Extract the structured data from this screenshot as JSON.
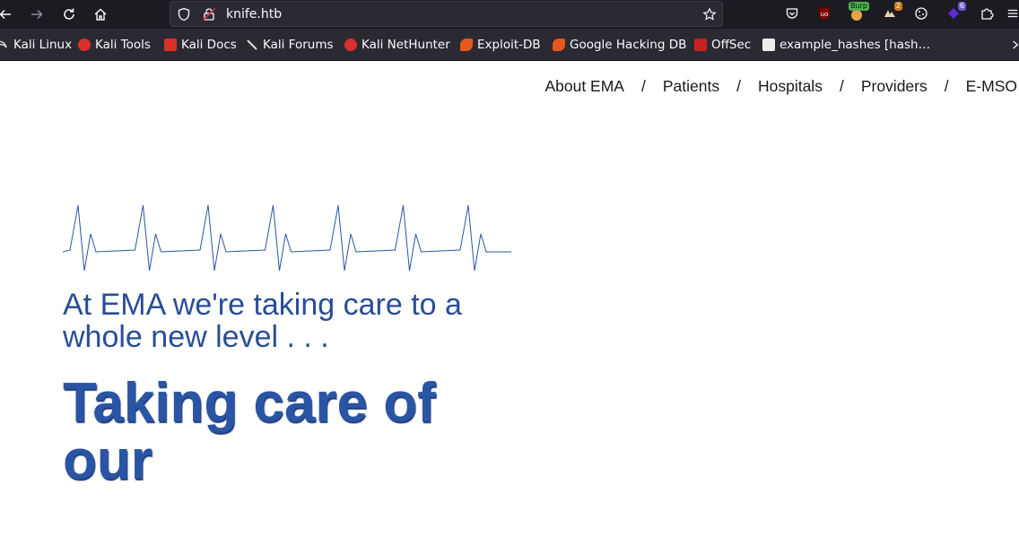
{
  "browser": {
    "url": "knife.htb",
    "extensions": [
      {
        "icon": "pocket-icon"
      },
      {
        "icon": "ublock-icon"
      },
      {
        "icon": "burp-icon",
        "badge": "Burp"
      },
      {
        "icon": "wappalyzer-icon",
        "badge": "2"
      },
      {
        "icon": "cookie-icon"
      },
      {
        "icon": "foxyproxy-icon",
        "badge": "6"
      },
      {
        "icon": "extensions-icon"
      }
    ]
  },
  "bookmarks": [
    {
      "label": "Kali Linux",
      "icon": "kali-dragon-icon",
      "color": "#dddddd"
    },
    {
      "label": "Kali Tools",
      "icon": "kali-tools-icon",
      "color": "#d8312b"
    },
    {
      "label": "Kali Docs",
      "icon": "kali-docs-icon",
      "color": "#d8312b"
    },
    {
      "label": "Kali Forums",
      "icon": "kali-forums-icon",
      "color": "#dddddd"
    },
    {
      "label": "Kali NetHunter",
      "icon": "kali-nethunter-icon",
      "color": "#d8312b"
    },
    {
      "label": "Exploit-DB",
      "icon": "exploit-db-icon",
      "color": "#e2581f"
    },
    {
      "label": "Google Hacking DB",
      "icon": "ghdb-icon",
      "color": "#e2581f"
    },
    {
      "label": "OffSec",
      "icon": "offsec-icon",
      "color": "#c42322"
    },
    {
      "label": "example_hashes [hash…",
      "icon": "hashcat-icon",
      "color": "#eeeeee"
    }
  ],
  "nav": {
    "items": [
      "About EMA",
      "Patients",
      "Hospitals",
      "Providers",
      "E-MSO"
    ],
    "separator": "/"
  },
  "hero": {
    "tagline": "At EMA we're taking care to a whole new level . . .",
    "headline": "Taking care of our"
  },
  "colors": {
    "accent": "#2a55a5",
    "tagline": "#2a4d98",
    "chrome": "#1c1b22"
  }
}
